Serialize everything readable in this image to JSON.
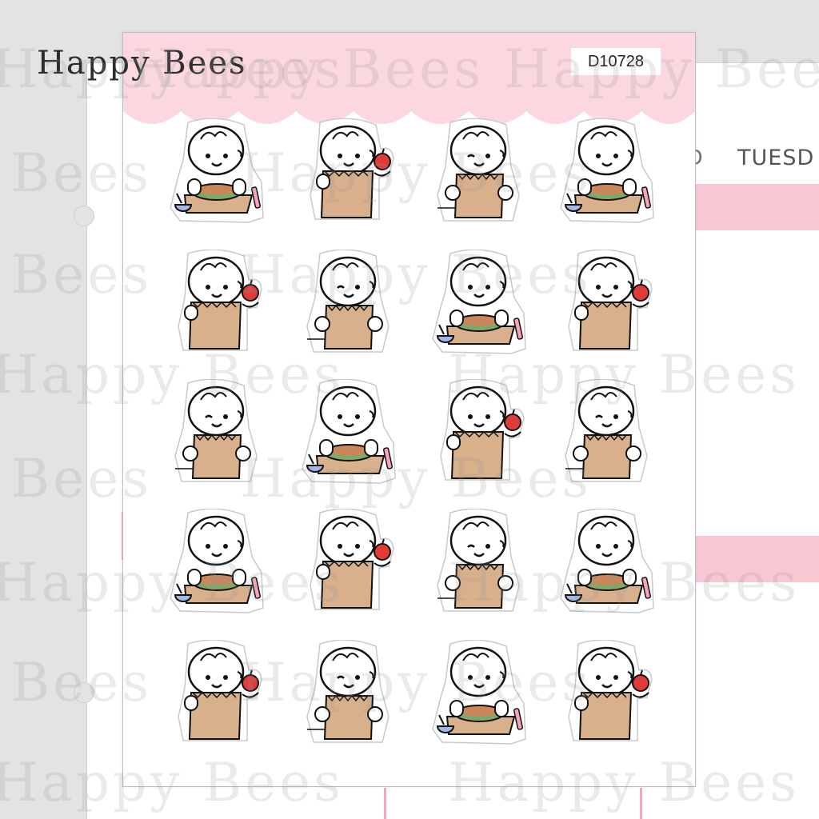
{
  "brand": "Happy Bees",
  "product_code": "D10728",
  "planner": {
    "day_label": "TUESD",
    "dot_label": "D"
  },
  "watermark": "Happy Bees",
  "colors": {
    "sheet_header": "#fbd8df",
    "planner_band": "#f7c7d2",
    "bag": "#d9b08c",
    "apple": "#e03a3a",
    "bowl": "#9fb8e8"
  },
  "stickers": [
    {
      "pose": "sandwich"
    },
    {
      "pose": "bag-apple"
    },
    {
      "pose": "bag-wink"
    },
    {
      "pose": "sandwich"
    },
    {
      "pose": "bag-apple"
    },
    {
      "pose": "bag-wink"
    },
    {
      "pose": "sandwich"
    },
    {
      "pose": "bag-apple"
    },
    {
      "pose": "bag-smile"
    },
    {
      "pose": "sandwich"
    },
    {
      "pose": "bag-apple"
    },
    {
      "pose": "bag-wink"
    },
    {
      "pose": "sandwich"
    },
    {
      "pose": "bag-apple"
    },
    {
      "pose": "bag-wink"
    },
    {
      "pose": "sandwich"
    },
    {
      "pose": "bag-apple"
    },
    {
      "pose": "bag-wink"
    },
    {
      "pose": "sandwich"
    },
    {
      "pose": "bag-apple"
    }
  ]
}
